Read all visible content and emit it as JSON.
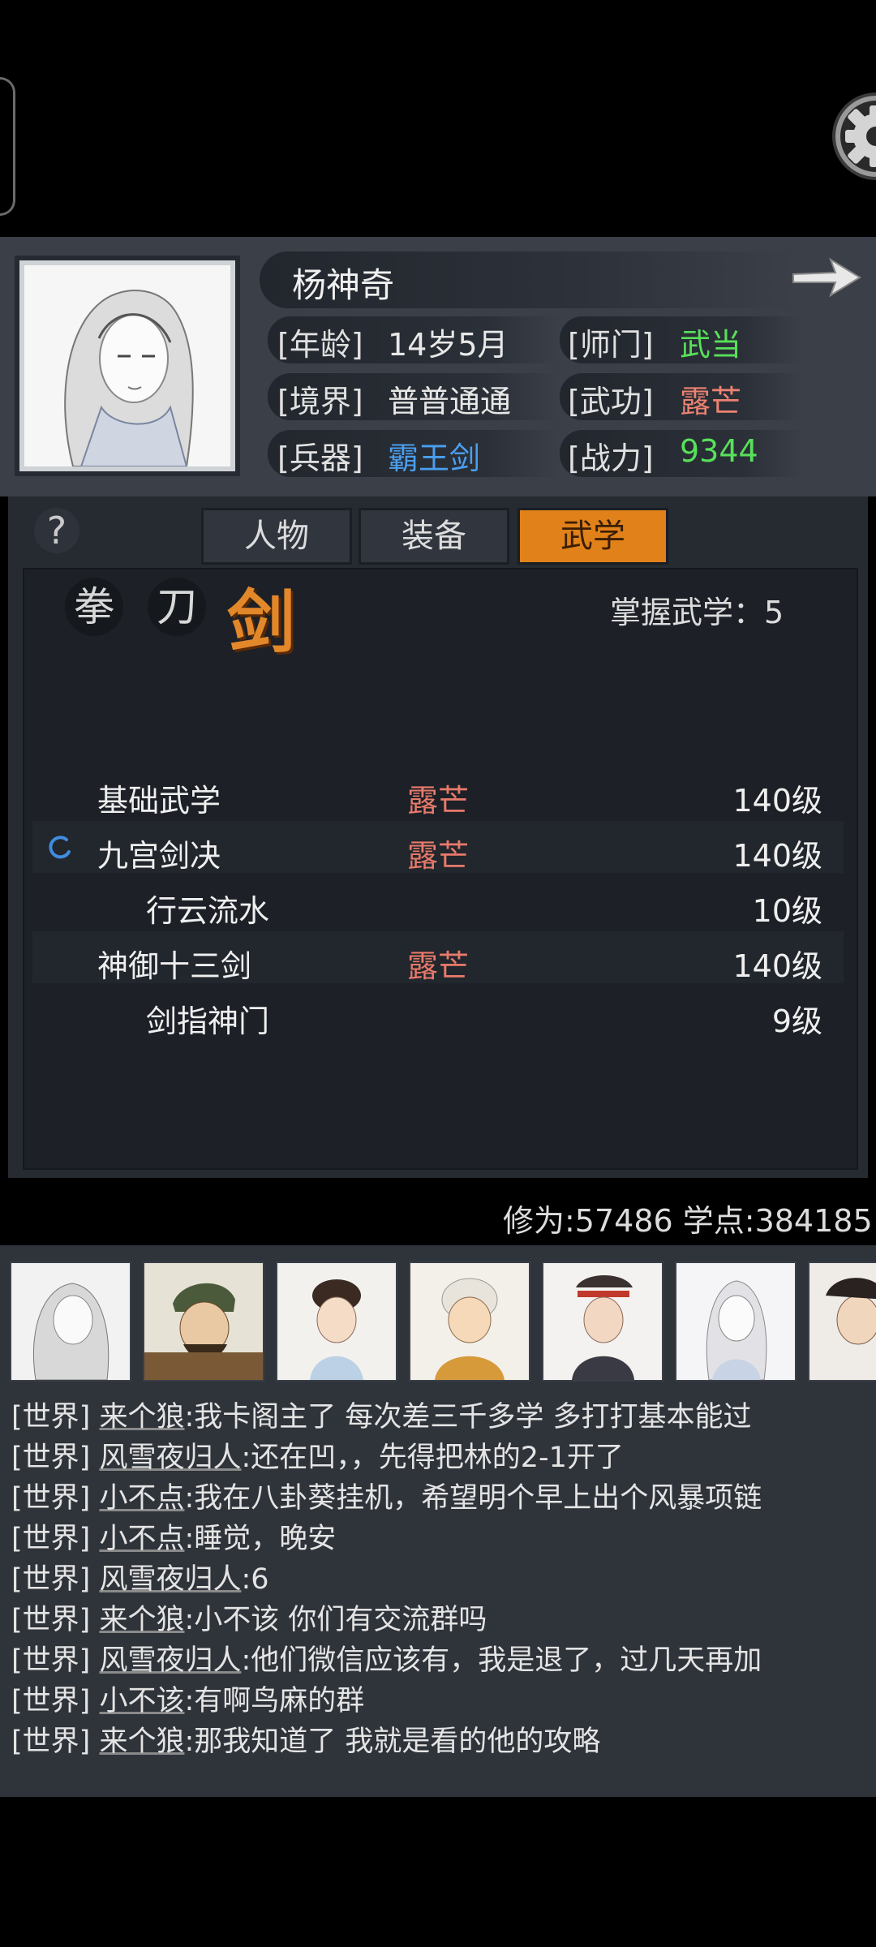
{
  "profile": {
    "name": "杨神奇",
    "stats": [
      {
        "label": "[年龄]",
        "value": "14岁5月",
        "color": "#e8e8e8"
      },
      {
        "label": "[师门]",
        "value": "武当",
        "color": "#58e05a"
      },
      {
        "label": "[境界]",
        "value": "普普通通",
        "color": "#e8e8e8"
      },
      {
        "label": "[武功]",
        "value": "露芒",
        "color": "#ee8272"
      },
      {
        "label": "[兵器]",
        "value": "霸王剑",
        "color": "#4a9ff0"
      },
      {
        "label": "[战力]",
        "value": "9344",
        "color": "#58e05a"
      }
    ]
  },
  "tabs": [
    "人物",
    "装备",
    "武学"
  ],
  "active_tab": "武学",
  "categories": {
    "fist": "拳",
    "blade": "刀",
    "sword": "剑"
  },
  "mastered": "掌握武学：5",
  "skills": [
    {
      "name": "基础武学",
      "realm": "露芒",
      "level": "140级"
    },
    {
      "name": "九宫剑决",
      "realm": "露芒",
      "level": "140级"
    },
    {
      "name": "行云流水",
      "realm": "",
      "level": "10级"
    },
    {
      "name": "神御十三剑",
      "realm": "露芒",
      "level": "140级"
    },
    {
      "name": "剑指神门",
      "realm": "",
      "level": "9级"
    }
  ],
  "cultivation": "修为:57486  学点:384185",
  "chat": [
    {
      "channel": "[世界]",
      "user": "来个狼",
      "msg": ":我卡阁主了 每次差三千多学 多打打基本能过"
    },
    {
      "channel": "[世界]",
      "user": "风雪夜归人",
      "msg": ":还在凹，，先得把林的2-1开了"
    },
    {
      "channel": "[世界]",
      "user": "小不点",
      "msg": ":我在八卦葵挂机，希望明个早上出个风暴项链"
    },
    {
      "channel": "[世界]",
      "user": "小不点",
      "msg": ":睡觉，晚安"
    },
    {
      "channel": "[世界]",
      "user": "风雪夜归人",
      "msg": ":6"
    },
    {
      "channel": "[世界]",
      "user": "来个狼",
      "msg": ":小不该 你们有交流群吗"
    },
    {
      "channel": "[世界]",
      "user": "风雪夜归人",
      "msg": ":他们微信应该有，我是退了，过几天再加"
    },
    {
      "channel": "[世界]",
      "user": "小不该",
      "msg": ":有啊鸟麻的群"
    },
    {
      "channel": "[世界]",
      "user": "来个狼",
      "msg": ":那我知道了 我就是看的他的攻略"
    }
  ]
}
